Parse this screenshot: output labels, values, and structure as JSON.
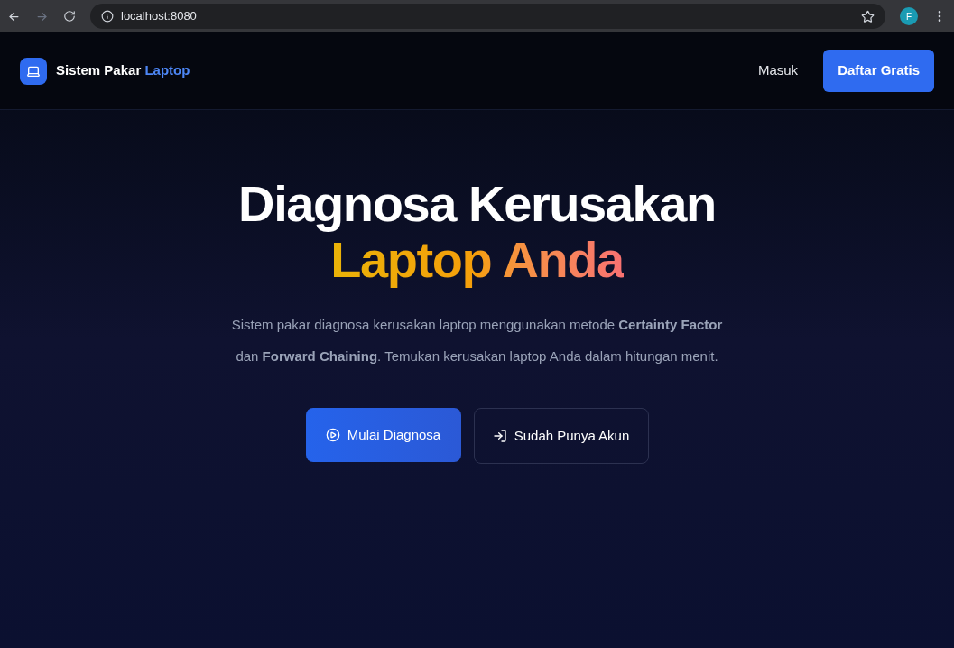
{
  "browser": {
    "url": "localhost:8080",
    "profile_initial": "F"
  },
  "navbar": {
    "brand": "Sistem Pakar",
    "brand_accent": "Laptop",
    "links": [
      {
        "label": "Masuk",
        "kind": "link"
      },
      {
        "label": "Daftar Gratis",
        "kind": "primary"
      }
    ]
  },
  "hero": {
    "title": "Diagnosa Kerusakan",
    "title_accent": "Laptop Anda",
    "description": "Sistem pakar diagnosa kerusakan laptop menggunakan metode **Certainty Factor** dan **Forward Chaining**. Temukan kerusakan laptop Anda dalam hitungan menit.",
    "buttons": [
      {
        "label": "Mulai Diagnosa",
        "kind": "primary"
      },
      {
        "label": "Sudah Punya Akun",
        "kind": "outline"
      }
    ]
  }
}
